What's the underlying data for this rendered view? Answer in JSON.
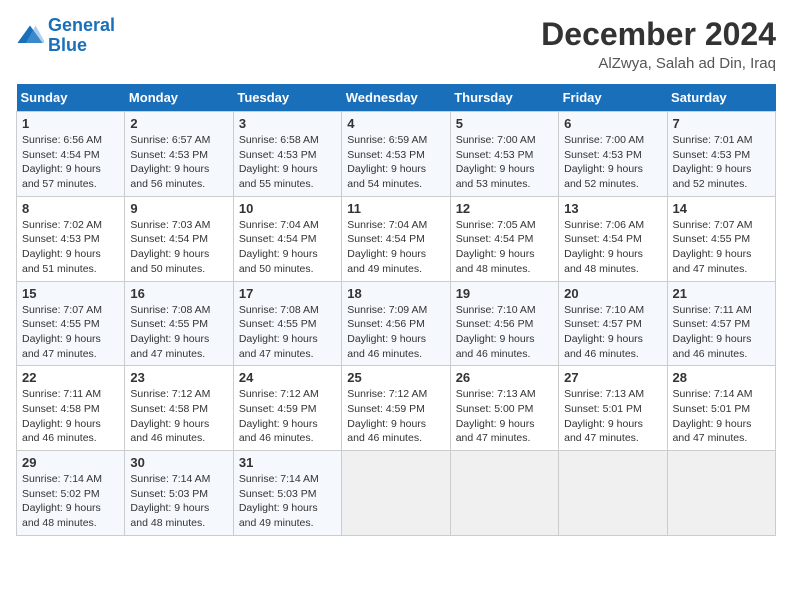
{
  "header": {
    "logo_general": "General",
    "logo_blue": "Blue",
    "month": "December 2024",
    "location": "AlZwya, Salah ad Din, Iraq"
  },
  "weekdays": [
    "Sunday",
    "Monday",
    "Tuesday",
    "Wednesday",
    "Thursday",
    "Friday",
    "Saturday"
  ],
  "weeks": [
    [
      {
        "day": "1",
        "sunrise": "Sunrise: 6:56 AM",
        "sunset": "Sunset: 4:54 PM",
        "daylight": "Daylight: 9 hours and 57 minutes."
      },
      {
        "day": "2",
        "sunrise": "Sunrise: 6:57 AM",
        "sunset": "Sunset: 4:53 PM",
        "daylight": "Daylight: 9 hours and 56 minutes."
      },
      {
        "day": "3",
        "sunrise": "Sunrise: 6:58 AM",
        "sunset": "Sunset: 4:53 PM",
        "daylight": "Daylight: 9 hours and 55 minutes."
      },
      {
        "day": "4",
        "sunrise": "Sunrise: 6:59 AM",
        "sunset": "Sunset: 4:53 PM",
        "daylight": "Daylight: 9 hours and 54 minutes."
      },
      {
        "day": "5",
        "sunrise": "Sunrise: 7:00 AM",
        "sunset": "Sunset: 4:53 PM",
        "daylight": "Daylight: 9 hours and 53 minutes."
      },
      {
        "day": "6",
        "sunrise": "Sunrise: 7:00 AM",
        "sunset": "Sunset: 4:53 PM",
        "daylight": "Daylight: 9 hours and 52 minutes."
      },
      {
        "day": "7",
        "sunrise": "Sunrise: 7:01 AM",
        "sunset": "Sunset: 4:53 PM",
        "daylight": "Daylight: 9 hours and 52 minutes."
      }
    ],
    [
      {
        "day": "8",
        "sunrise": "Sunrise: 7:02 AM",
        "sunset": "Sunset: 4:53 PM",
        "daylight": "Daylight: 9 hours and 51 minutes."
      },
      {
        "day": "9",
        "sunrise": "Sunrise: 7:03 AM",
        "sunset": "Sunset: 4:54 PM",
        "daylight": "Daylight: 9 hours and 50 minutes."
      },
      {
        "day": "10",
        "sunrise": "Sunrise: 7:04 AM",
        "sunset": "Sunset: 4:54 PM",
        "daylight": "Daylight: 9 hours and 50 minutes."
      },
      {
        "day": "11",
        "sunrise": "Sunrise: 7:04 AM",
        "sunset": "Sunset: 4:54 PM",
        "daylight": "Daylight: 9 hours and 49 minutes."
      },
      {
        "day": "12",
        "sunrise": "Sunrise: 7:05 AM",
        "sunset": "Sunset: 4:54 PM",
        "daylight": "Daylight: 9 hours and 48 minutes."
      },
      {
        "day": "13",
        "sunrise": "Sunrise: 7:06 AM",
        "sunset": "Sunset: 4:54 PM",
        "daylight": "Daylight: 9 hours and 48 minutes."
      },
      {
        "day": "14",
        "sunrise": "Sunrise: 7:07 AM",
        "sunset": "Sunset: 4:55 PM",
        "daylight": "Daylight: 9 hours and 47 minutes."
      }
    ],
    [
      {
        "day": "15",
        "sunrise": "Sunrise: 7:07 AM",
        "sunset": "Sunset: 4:55 PM",
        "daylight": "Daylight: 9 hours and 47 minutes."
      },
      {
        "day": "16",
        "sunrise": "Sunrise: 7:08 AM",
        "sunset": "Sunset: 4:55 PM",
        "daylight": "Daylight: 9 hours and 47 minutes."
      },
      {
        "day": "17",
        "sunrise": "Sunrise: 7:08 AM",
        "sunset": "Sunset: 4:55 PM",
        "daylight": "Daylight: 9 hours and 47 minutes."
      },
      {
        "day": "18",
        "sunrise": "Sunrise: 7:09 AM",
        "sunset": "Sunset: 4:56 PM",
        "daylight": "Daylight: 9 hours and 46 minutes."
      },
      {
        "day": "19",
        "sunrise": "Sunrise: 7:10 AM",
        "sunset": "Sunset: 4:56 PM",
        "daylight": "Daylight: 9 hours and 46 minutes."
      },
      {
        "day": "20",
        "sunrise": "Sunrise: 7:10 AM",
        "sunset": "Sunset: 4:57 PM",
        "daylight": "Daylight: 9 hours and 46 minutes."
      },
      {
        "day": "21",
        "sunrise": "Sunrise: 7:11 AM",
        "sunset": "Sunset: 4:57 PM",
        "daylight": "Daylight: 9 hours and 46 minutes."
      }
    ],
    [
      {
        "day": "22",
        "sunrise": "Sunrise: 7:11 AM",
        "sunset": "Sunset: 4:58 PM",
        "daylight": "Daylight: 9 hours and 46 minutes."
      },
      {
        "day": "23",
        "sunrise": "Sunrise: 7:12 AM",
        "sunset": "Sunset: 4:58 PM",
        "daylight": "Daylight: 9 hours and 46 minutes."
      },
      {
        "day": "24",
        "sunrise": "Sunrise: 7:12 AM",
        "sunset": "Sunset: 4:59 PM",
        "daylight": "Daylight: 9 hours and 46 minutes."
      },
      {
        "day": "25",
        "sunrise": "Sunrise: 7:12 AM",
        "sunset": "Sunset: 4:59 PM",
        "daylight": "Daylight: 9 hours and 46 minutes."
      },
      {
        "day": "26",
        "sunrise": "Sunrise: 7:13 AM",
        "sunset": "Sunset: 5:00 PM",
        "daylight": "Daylight: 9 hours and 47 minutes."
      },
      {
        "day": "27",
        "sunrise": "Sunrise: 7:13 AM",
        "sunset": "Sunset: 5:01 PM",
        "daylight": "Daylight: 9 hours and 47 minutes."
      },
      {
        "day": "28",
        "sunrise": "Sunrise: 7:14 AM",
        "sunset": "Sunset: 5:01 PM",
        "daylight": "Daylight: 9 hours and 47 minutes."
      }
    ],
    [
      {
        "day": "29",
        "sunrise": "Sunrise: 7:14 AM",
        "sunset": "Sunset: 5:02 PM",
        "daylight": "Daylight: 9 hours and 48 minutes."
      },
      {
        "day": "30",
        "sunrise": "Sunrise: 7:14 AM",
        "sunset": "Sunset: 5:03 PM",
        "daylight": "Daylight: 9 hours and 48 minutes."
      },
      {
        "day": "31",
        "sunrise": "Sunrise: 7:14 AM",
        "sunset": "Sunset: 5:03 PM",
        "daylight": "Daylight: 9 hours and 49 minutes."
      },
      null,
      null,
      null,
      null
    ]
  ]
}
